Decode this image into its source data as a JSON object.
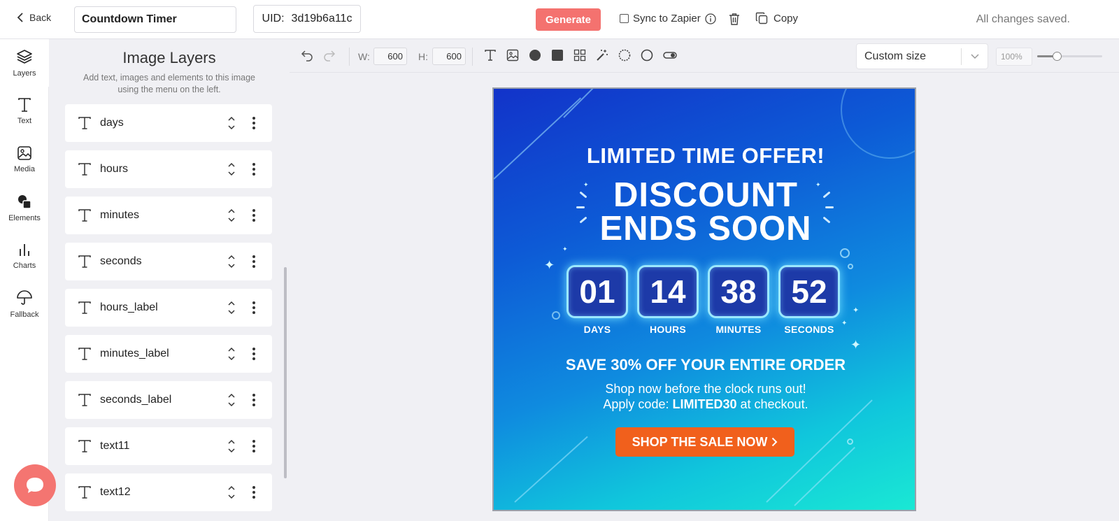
{
  "topbar": {
    "back_label": "Back",
    "template_name": "Countdown Timer",
    "uid_label": "UID:",
    "uid_value": "3d19b6a11c",
    "generate_label": "Generate",
    "sync_label": "Sync to Zapier",
    "sync_checked": false,
    "copy_label": "Copy",
    "status_text": "All changes saved."
  },
  "rail": {
    "items": [
      {
        "label": "Layers",
        "icon": "layers-icon",
        "active": true
      },
      {
        "label": "Text",
        "icon": "text-icon"
      },
      {
        "label": "Media",
        "icon": "image-icon"
      },
      {
        "label": "Elements",
        "icon": "shapes-icon"
      },
      {
        "label": "Charts",
        "icon": "bar-chart-icon"
      },
      {
        "label": "Fallback",
        "icon": "umbrella-icon"
      }
    ]
  },
  "panel": {
    "title": "Image Layers",
    "description": "Add text, images and elements to this image using the menu on the left.",
    "layers": [
      {
        "name": "days"
      },
      {
        "name": "hours"
      },
      {
        "name": "minutes"
      },
      {
        "name": "seconds"
      },
      {
        "name": "hours_label"
      },
      {
        "name": "minutes_label"
      },
      {
        "name": "seconds_label"
      },
      {
        "name": "text11"
      },
      {
        "name": "text12"
      }
    ]
  },
  "toolbar": {
    "width_label": "W:",
    "width_value": "600",
    "height_label": "H:",
    "height_value": "600",
    "size_preset": "Custom size",
    "zoom_value": "100%",
    "zoom_level": 0.3,
    "tools": [
      "undo-icon",
      "redo-icon",
      "text-tool-icon",
      "image-tool-icon",
      "circle-tool-icon",
      "square-tool-icon",
      "grid-tool-icon",
      "magic-wand-icon",
      "dashed-circle-icon",
      "ring-tool-icon",
      "toggle-icon"
    ]
  },
  "canvas": {
    "headline": "LIMITED TIME OFFER!",
    "discount_line1": "DISCOUNT",
    "discount_line2": "ENDS SOON",
    "countdown": [
      {
        "value": "01",
        "label": "DAYS"
      },
      {
        "value": "14",
        "label": "HOURS"
      },
      {
        "value": "38",
        "label": "MINUTES"
      },
      {
        "value": "52",
        "label": "SECONDS"
      }
    ],
    "save_text": "SAVE 30% OFF YOUR ENTIRE ORDER",
    "shop_line": "Shop now before the clock runs out!",
    "apply_prefix": "Apply code:",
    "promo_code": "LIMITED30",
    "apply_suffix": "at checkout.",
    "cta_label": "SHOP THE SALE NOW",
    "colors": {
      "gradient_start": "#1233c9",
      "gradient_end": "#1ae8d4",
      "tile_bg": "#1d3aa8",
      "cta_bg": "#f1601c"
    }
  },
  "colors": {
    "generate_button": "#f4726f",
    "chat_bubble": "#f47571"
  }
}
